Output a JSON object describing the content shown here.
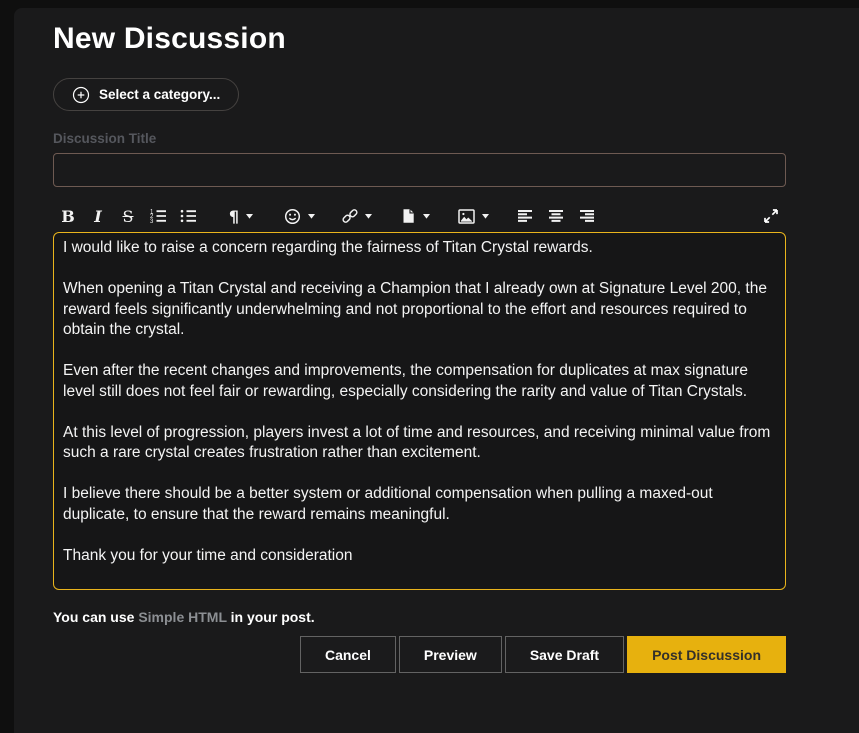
{
  "page": {
    "title": "New Discussion"
  },
  "category": {
    "label": "Select a category...",
    "icon": "circle-plus-icon"
  },
  "title_field": {
    "label": "Discussion Title",
    "value": "",
    "placeholder": ""
  },
  "toolbar": {
    "bold_label": "B",
    "italic_label": "I",
    "strike_label": "S",
    "paragraph_label": "¶",
    "buttons": [
      "bold",
      "italic",
      "strikethrough",
      "ordered-list",
      "unordered-list",
      "paragraph-format",
      "emoji",
      "link",
      "attach-file",
      "insert-image",
      "align-left",
      "align-center",
      "align-right",
      "expand"
    ]
  },
  "editor": {
    "body": "I would like to raise a concern regarding the fairness of Titan Crystal rewards.\n\nWhen opening a Titan Crystal and receiving a Champion that I already own at Signature Level 200, the reward feels significantly underwhelming and not proportional to the effort and resources required to obtain the crystal.\n\nEven after the recent changes and improvements, the compensation for duplicates at max signature level still does not feel fair or rewarding, especially considering the rarity and value of Titan Crystals.\n\nAt this level of progression, players invest a lot of time and resources, and receiving minimal value from such a rare crystal creates frustration rather than excitement.\n\nI believe there should be a better system or additional compensation when pulling a maxed-out duplicate, to ensure that the reward remains meaningful.\n\nThank you for your time and consideration"
  },
  "footer": {
    "note_prefix": "You can use ",
    "note_link": "Simple HTML",
    "note_suffix": " in your post.",
    "buttons": [
      {
        "label": "Cancel"
      },
      {
        "label": "Preview"
      },
      {
        "label": "Save Draft"
      },
      {
        "label": "Post Discussion"
      }
    ]
  },
  "colors": {
    "accent_yellow": "#e7b10e",
    "editor_border": "#e9b41c",
    "title_input_border": "#6e5a52",
    "panel_background": "#1a1a1b",
    "muted_label": "#55575d"
  }
}
